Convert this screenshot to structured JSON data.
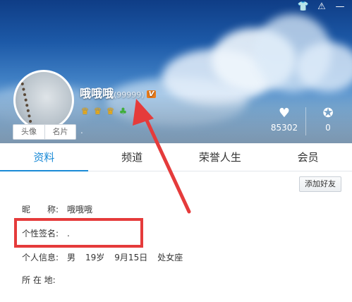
{
  "window": {
    "controls": [
      "👕",
      "⚠",
      "—"
    ]
  },
  "header": {
    "nickname": "哦哦哦",
    "qq_number": "(99999)",
    "vip_label": "V",
    "signature_preview": ".",
    "stats": {
      "likes_count": "85302",
      "honor_count": "0"
    }
  },
  "avatar_tabs": [
    "头像",
    "名片"
  ],
  "tabs": [
    {
      "label": "资料",
      "active": true
    },
    {
      "label": "频道",
      "active": false
    },
    {
      "label": "荣誉人生",
      "active": false
    },
    {
      "label": "会员",
      "active": false
    }
  ],
  "actions": {
    "add_friend": "添加好友"
  },
  "profile": {
    "nickname_label": "昵　　称:",
    "nickname_value": "哦哦哦",
    "signature_label": "个性签名:",
    "signature_value": ".",
    "personal_label": "个人信息:",
    "gender": "男",
    "age": "19岁",
    "birthday": "9月15日",
    "zodiac": "处女座",
    "location_label": "所 在 地:",
    "location_value": ""
  },
  "colors": {
    "accent": "#1a8ad6",
    "annotation": "#e53b3b"
  }
}
